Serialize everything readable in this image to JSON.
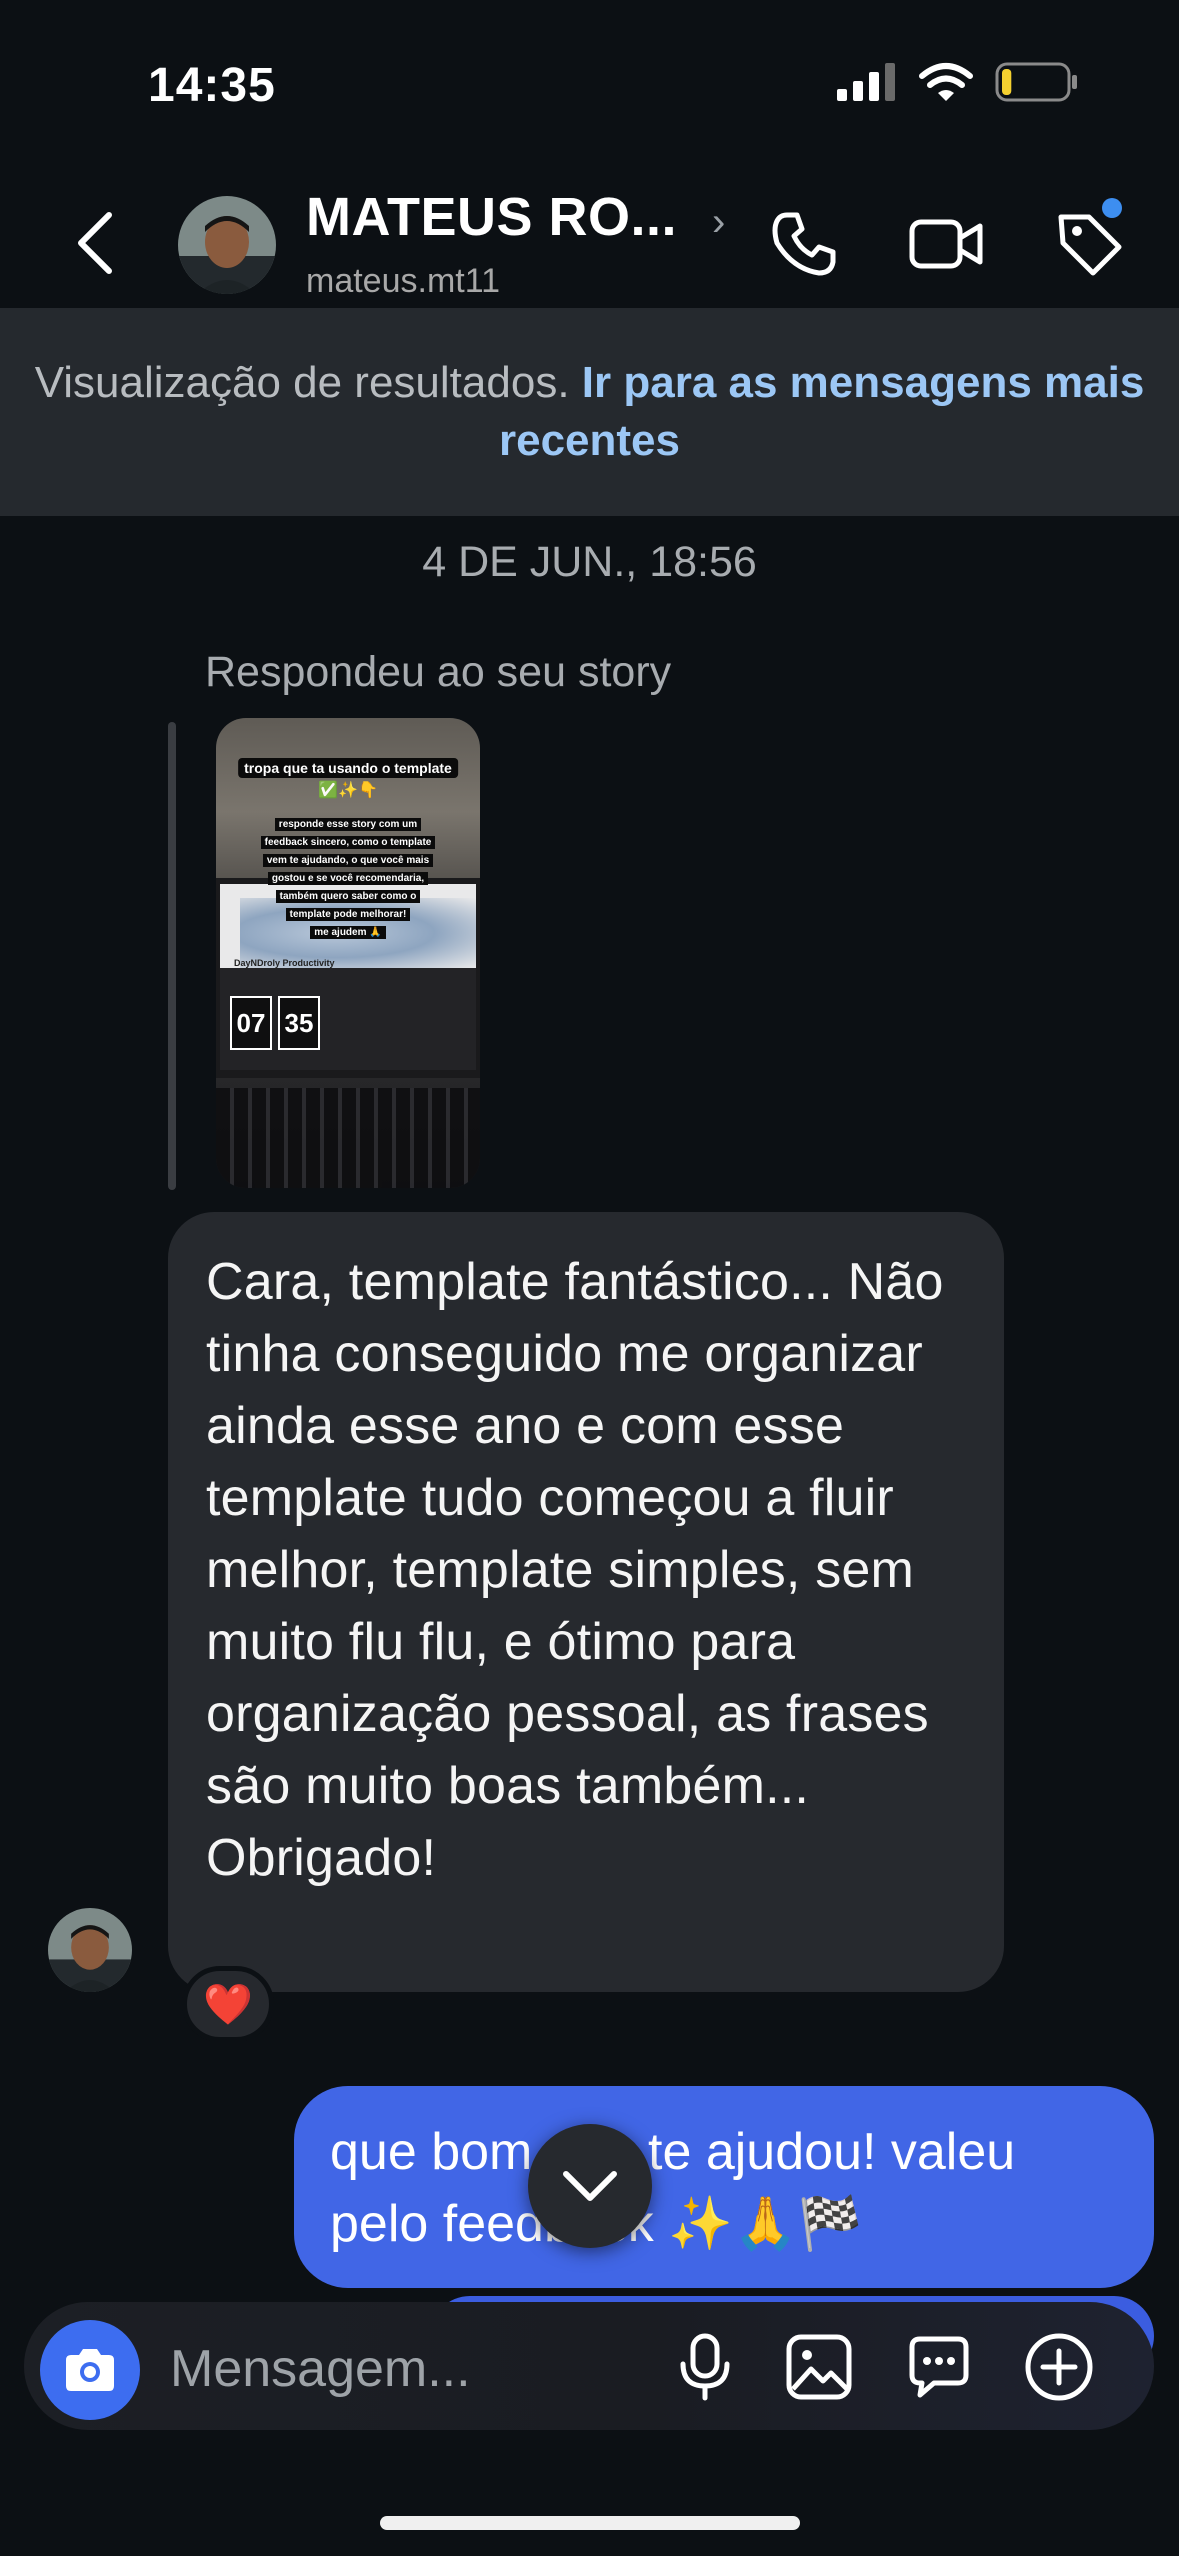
{
  "status_bar": {
    "time": "14:35",
    "battery_level": 0.15
  },
  "header": {
    "contact_name": "MATEUS RO...",
    "contact_handle": "mateus.mt11",
    "icons": [
      "back-chevron-icon",
      "phone-icon",
      "video-camera-icon",
      "tag-icon"
    ]
  },
  "banner": {
    "text": "Visualização de resultados.",
    "link": "Ir para as mensagens mais recentes"
  },
  "timestamp": "4 DE JUN., 18:56",
  "story_reply": {
    "label": "Respondeu ao seu story",
    "thumbnail": {
      "sticker_title": "tropa que ta usando o template",
      "sticker_emojis": "✅✨👇",
      "sticker_body_lines": [
        "responde esse story com um",
        "feedback sincero, como o template",
        "vem te ajudando, o que você mais",
        "gostou e se você recomendaria,",
        "também quero saber como o",
        "template pode melhorar!",
        "me ajudem 🙏"
      ],
      "screen_title": "DayNDroly Productivity",
      "clock_hours": "07",
      "clock_minutes": "35"
    }
  },
  "messages": [
    {
      "direction": "incoming",
      "text": "Cara, template fantástico... Não tinha conseguido me organizar ainda esse ano e com esse template tudo começou a fluir melhor, template simples, sem muito flu flu, e ótimo para organização pessoal, as frases são muito boas também... Obrigado!",
      "reaction": "❤️"
    },
    {
      "direction": "outgoing",
      "text": "que bom que te ajudou! valeu pelo feedback ✨🙏🏁"
    }
  ],
  "composer": {
    "placeholder": "Mensagem...",
    "icons": [
      "camera-icon",
      "microphone-icon",
      "gallery-icon",
      "sticker-icon",
      "plus-icon"
    ]
  },
  "colors": {
    "background": "#0c1014",
    "incoming_bubble": "#26292e",
    "outgoing_bubble": "#4166e6",
    "link": "#9cc7f5",
    "notification_dot": "#3d8ef0"
  }
}
